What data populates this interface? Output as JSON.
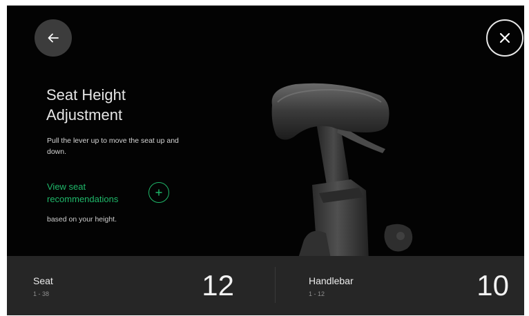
{
  "header": {
    "back_icon": "arrow-left-icon",
    "close_icon": "close-icon"
  },
  "content": {
    "title": "Seat Height Adjustment",
    "description": "Pull the lever up to move the seat up and down.",
    "recommendation_link": "View seat recommendations",
    "recommendation_icon": "plus-circle-icon",
    "recommendation_sub": "based on your height."
  },
  "settings": {
    "seat": {
      "label": "Seat",
      "range": "1 - 38",
      "value": "12"
    },
    "handlebar": {
      "label": "Handlebar",
      "range": "1 - 12",
      "value": "10"
    }
  },
  "colors": {
    "background": "#030303",
    "accent": "#1fb86a",
    "bottom_bar": "#262626"
  }
}
